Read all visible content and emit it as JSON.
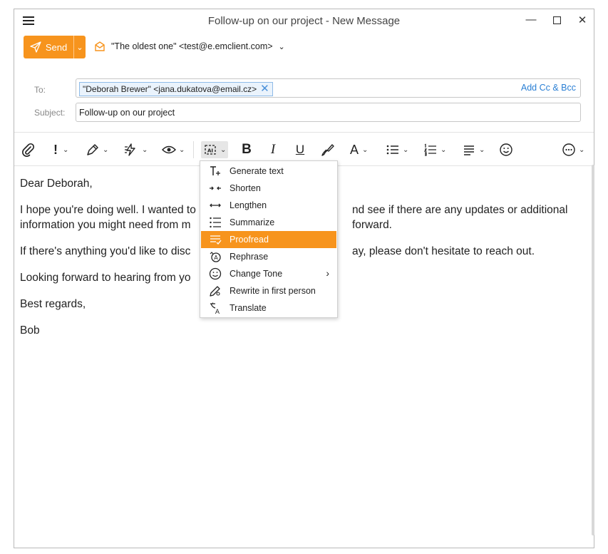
{
  "window": {
    "title": "Follow-up on our project - New Message"
  },
  "toolbar_top": {
    "send_label": "Send",
    "from_value": "\"The oldest one\" <test@e.emclient.com>"
  },
  "fields": {
    "to_label": "To:",
    "to_recipient": "\"Deborah Brewer\" <jana.dukatova@email.cz>",
    "add_cc_bcc": "Add Cc & Bcc",
    "subject_label": "Subject:",
    "subject_value": "Follow-up on our project"
  },
  "body": {
    "line1": "Dear Deborah,",
    "line2a": "I hope you're doing well. I wanted to",
    "line2b": "nd see if there are any updates or additional",
    "line3a": "information you might need from m",
    "line3b": "forward.",
    "line4a": "If there's anything you'd like to disc",
    "line4b": "ay, please don't hesitate to reach out.",
    "line5": "Looking forward to hearing from yo",
    "line6": "Best regards,",
    "line7": "Bob"
  },
  "ai_menu": {
    "items": [
      {
        "label": "Generate text",
        "icon": "generate-text-icon"
      },
      {
        "label": "Shorten",
        "icon": "shorten-icon"
      },
      {
        "label": "Lengthen",
        "icon": "lengthen-icon"
      },
      {
        "label": "Summarize",
        "icon": "summarize-icon"
      },
      {
        "label": "Proofread",
        "icon": "proofread-icon",
        "active": true
      },
      {
        "label": "Rephrase",
        "icon": "rephrase-icon"
      },
      {
        "label": "Change Tone",
        "icon": "change-tone-icon",
        "submenu": true
      },
      {
        "label": "Rewrite in first person",
        "icon": "rewrite-icon"
      },
      {
        "label": "Translate",
        "icon": "translate-icon"
      }
    ]
  },
  "colors": {
    "accent": "#f7941d",
    "link": "#2a7fd4",
    "chip_border": "#8fbbe8"
  }
}
